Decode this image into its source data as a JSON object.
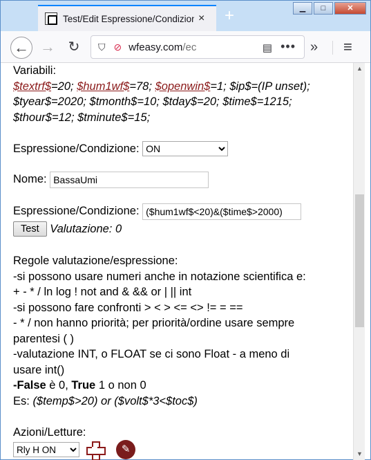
{
  "window": {
    "tab_title": "Test/Edit Espressione/Condizione",
    "tab_close": "×",
    "new_tab": "+",
    "minimize": "▁",
    "maximize": "□",
    "close": "✕"
  },
  "navbar": {
    "back": "←",
    "forward": "→",
    "reload": "↻",
    "url_domain": "wfeasy.com",
    "url_path": "/ec",
    "more": "•••",
    "overflow": "»",
    "menu": "≡"
  },
  "vars": {
    "heading": "Variabili:",
    "v1_name": "$textrf$",
    "v1_val": "=20; ",
    "v2_name": "$hum1wf$",
    "v2_val": "=78; ",
    "v3_name": "$openwin$",
    "v3_val": "=1; $ip$=(IP unset);",
    "line2": "$tyear$=2020; $tmonth$=10; $tday$=20; $time$=1215;",
    "line3": "$thour$=12; $tminute$=15;"
  },
  "form": {
    "expr_label_1": "Espressione/Condizione:",
    "expr_select_value": "ON",
    "name_label": "Nome:",
    "name_value": "BassaUmi",
    "expr_label_2": "Espressione/Condizione:",
    "expr_value": "($hum1wf$<20)&($time$>2000)",
    "test_button": "Test",
    "result": "Valutazione: 0"
  },
  "rules": {
    "heading": "Regole valutazione/espressione:",
    "l1": "-si possono usare numeri anche in notazione scientifica e:",
    "l2": "+ - * / ln log ! not and & && or | || int",
    "l3": "-si possono fare confronti > < > <= <> != = ==",
    "l4": "- * / non hanno priorità; per priorità/ordine usare sempre",
    "l5": "parentesi ( )",
    "l6": "-valutazione INT, o FLOAT se ci sono Float - a meno di",
    "l7": "usare int()",
    "l8_false": "-False",
    "l8_mid": " è 0, ",
    "l8_true": "True",
    "l8_end": " 1 o non 0",
    "l9_prefix": "Es: ",
    "l9_example": "($temp$>20) or ($volt$*3<$toc$)"
  },
  "actions": {
    "heading": "Azioni/Letture:",
    "select_value": "Rly H ON"
  },
  "icons": {
    "edit": "✎"
  }
}
